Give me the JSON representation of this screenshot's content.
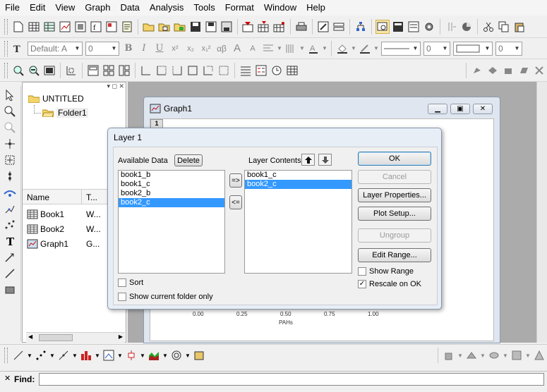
{
  "menu": [
    "File",
    "Edit",
    "View",
    "Graph",
    "Data",
    "Analysis",
    "Tools",
    "Format",
    "Window",
    "Help"
  ],
  "format_toolbar": {
    "font_value": "Default: A",
    "size_value": "0",
    "bold": "B",
    "italic": "I",
    "underline": "U",
    "superscript": "x²",
    "subscript": "x₂",
    "supsub": "x₁²",
    "greek": "αβ",
    "grow_font": "A",
    "shrink_font": "A",
    "line_width_value": "0",
    "pattern_value": "0"
  },
  "explorer": {
    "root_folder": "UNTITLED",
    "sub_folder": "Folder1",
    "col_name": "Name",
    "col_type": "T...",
    "items": [
      {
        "name": "Book1",
        "type": "W..."
      },
      {
        "name": "Book2",
        "type": "W..."
      },
      {
        "name": "Graph1",
        "type": "G..."
      }
    ]
  },
  "graph_window": {
    "title": "Graph1",
    "layer_tab": "1",
    "x_ticks": [
      "0.00",
      "0.25",
      "0.50",
      "0.75",
      "1.00"
    ],
    "x_label": "PAHs"
  },
  "dialog": {
    "title": "Layer 1",
    "available_label": "Available Data",
    "delete_label": "Delete",
    "available_items": [
      "book1_b",
      "book1_c",
      "book2_b",
      "book2_c"
    ],
    "available_selected": 3,
    "add_arrow": "=>",
    "remove_arrow": "<=",
    "contents_label": "Layer Contents",
    "contents_items": [
      "book1_c",
      "book2_c"
    ],
    "contents_selected": 1,
    "ok": "OK",
    "cancel": "Cancel",
    "layer_properties": "Layer Properties...",
    "plot_setup": "Plot Setup...",
    "ungroup": "Ungroup",
    "edit_range": "Edit Range...",
    "show_range": "Show Range",
    "show_range_checked": false,
    "rescale_on_ok": "Rescale on OK",
    "rescale_checked": true,
    "sort": "Sort",
    "sort_checked": false,
    "show_current_folder": "Show current folder only",
    "show_current_folder_checked": false
  },
  "find": {
    "label": "Find:",
    "value": ""
  },
  "colors": {
    "selection": "#3399ff",
    "workspace": "#ababab",
    "dialog_frame": "#e8eef6"
  }
}
